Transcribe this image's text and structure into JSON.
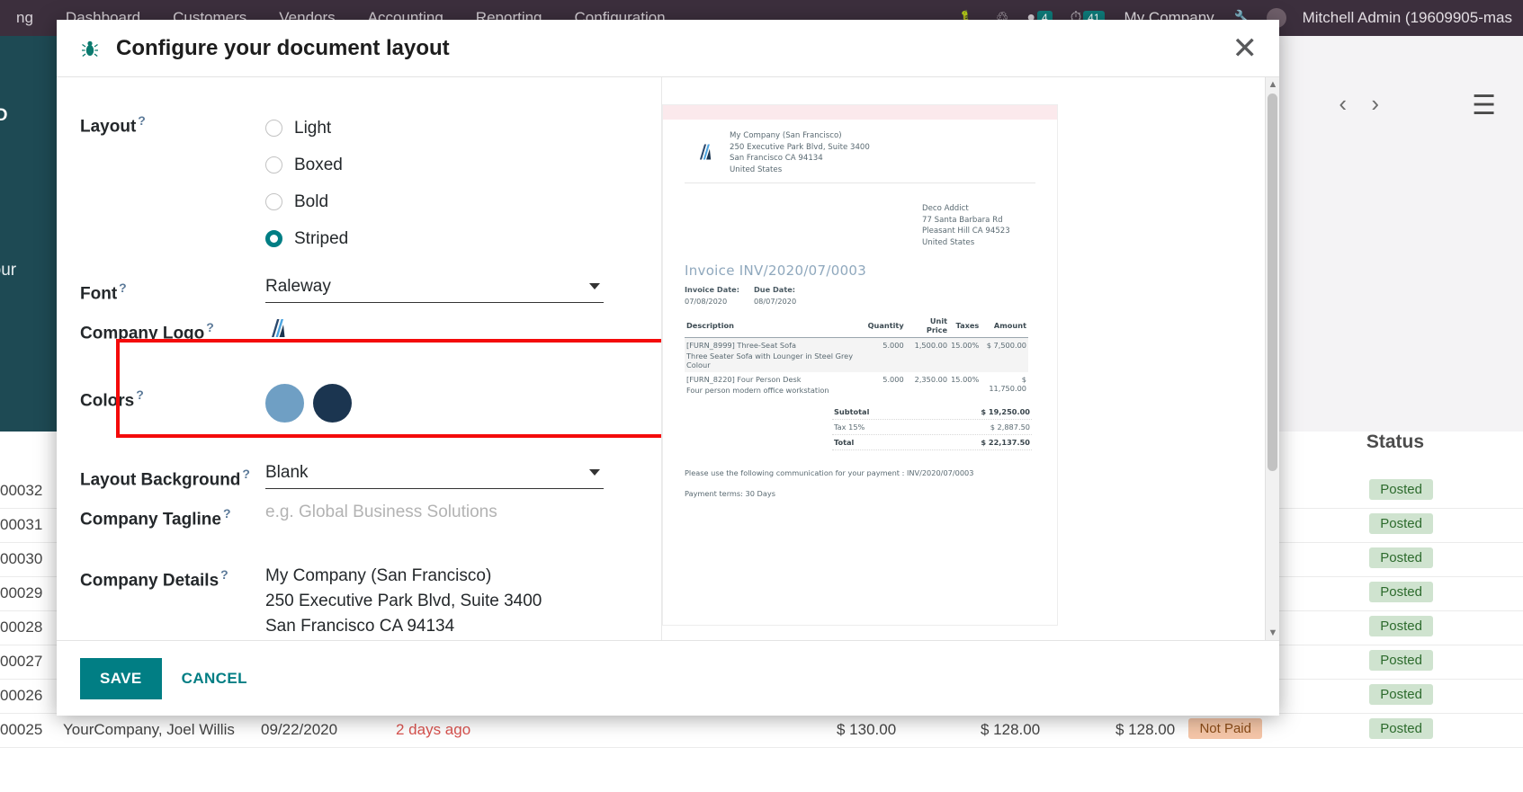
{
  "topbar": {
    "menu": [
      "Dashboard",
      "Customers",
      "Vendors",
      "Accounting",
      "Reporting",
      "Configuration"
    ],
    "left_cut": "ng",
    "icons": [
      "bug-icon",
      "headset-icon",
      "messages-icon",
      "clock-icon"
    ],
    "messages_count": "4",
    "activities_count": "41",
    "company": "My Company",
    "user": "Mitchell Admin (19609905-mas"
  },
  "background": {
    "upload_label": "PLOAD",
    "set_your": "et your",
    "status_header": "Status",
    "rows": [
      {
        "num": "00032",
        "status": "Posted"
      },
      {
        "num": "00031",
        "status": "Posted"
      },
      {
        "num": "00030",
        "status": "Posted"
      },
      {
        "num": "00029",
        "status": "Posted"
      },
      {
        "num": "00028",
        "status": "Posted"
      },
      {
        "num": "00027",
        "status": "Posted"
      },
      {
        "num": "00026",
        "status": "Posted"
      }
    ],
    "last_row": {
      "num": "00025",
      "company": "YourCompany, Joel Willis",
      "date": "09/22/2020",
      "due": "2 days ago",
      "a1": "$ 130.00",
      "a2": "$ 128.00",
      "a3": "$ 128.00",
      "status": "Not Paid",
      "status2": "Posted"
    }
  },
  "dialog": {
    "title": "Configure your document layout",
    "close_icon": "close-icon",
    "bug_icon": "bug-icon",
    "layout": {
      "label": "Layout",
      "options": [
        "Light",
        "Boxed",
        "Bold",
        "Striped"
      ],
      "selected": "Striped"
    },
    "font": {
      "label": "Font",
      "value": "Raleway"
    },
    "company_logo": {
      "label": "Company Logo",
      "icon": "company-logo-icon"
    },
    "colors": {
      "label": "Colors",
      "primary": "#6f9fc4",
      "secondary": "#1b3550"
    },
    "layout_background": {
      "label": "Layout Background",
      "value": "Blank"
    },
    "company_tagline": {
      "label": "Company Tagline",
      "placeholder": "e.g. Global Business Solutions",
      "value": ""
    },
    "company_details": {
      "label": "Company Details",
      "lines": [
        "My Company (San Francisco)",
        "250 Executive Park Blvd, Suite 3400",
        "San Francisco CA 94134"
      ]
    },
    "footer": {
      "save": "SAVE",
      "cancel": "CANCEL"
    }
  },
  "preview": {
    "company_address": [
      "My Company (San Francisco)",
      "250 Executive Park Blvd, Suite 3400",
      "San Francisco CA 94134",
      "United States"
    ],
    "customer_address": [
      "Deco Addict",
      "77 Santa Barbara Rd",
      "Pleasant Hill CA 94523",
      "United States"
    ],
    "invoice_title": "Invoice INV/2020/07/0003",
    "invoice_date_label": "Invoice Date:",
    "invoice_date": "07/08/2020",
    "due_date_label": "Due Date:",
    "due_date": "08/07/2020",
    "columns": [
      "Description",
      "Quantity",
      "Unit Price",
      "Taxes",
      "Amount"
    ],
    "lines": [
      {
        "description": "[FURN_8999] Three-Seat Sofa",
        "sub": "Three Seater Sofa with Lounger in Steel Grey Colour",
        "quantity": "5.000",
        "unit_price": "1,500.00",
        "taxes": "15.00%",
        "amount": "$ 7,500.00"
      },
      {
        "description": "[FURN_8220] Four Person Desk",
        "sub": "Four person modern office workstation",
        "quantity": "5.000",
        "unit_price": "2,350.00",
        "taxes": "15.00%",
        "amount": "$ 11,750.00"
      }
    ],
    "totals": [
      {
        "label": "Subtotal",
        "value": "$ 19,250.00",
        "bold": true
      },
      {
        "label": "Tax 15%",
        "value": "$ 2,887.50",
        "bold": false
      },
      {
        "label": "Total",
        "value": "$ 22,137.50",
        "bold": true
      }
    ],
    "payment_note": "Please use the following communication for your payment : INV/2020/07/0003",
    "payment_terms": "Payment terms: 30 Days"
  }
}
